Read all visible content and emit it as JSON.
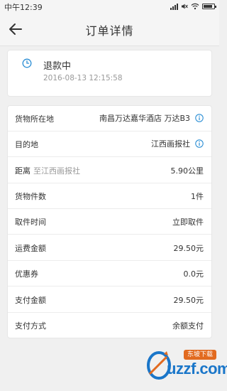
{
  "status_bar": {
    "time": "中午12:39",
    "battery_level": 0.85
  },
  "header": {
    "title": "订单详情",
    "back_icon": "arrow-left-icon"
  },
  "order_status": {
    "icon": "clock-icon",
    "label": "退款中",
    "timestamp": "2016-08-13 12:15:58"
  },
  "details": {
    "rows": [
      {
        "label": "货物所在地",
        "sub": "",
        "value": "南昌万达嘉华酒店 万达B3",
        "info_icon": true
      },
      {
        "label": "目的地",
        "sub": "",
        "value": "江西画报社",
        "info_icon": true
      },
      {
        "label": "距离",
        "sub": "至江西画报社",
        "value": "5.90公里",
        "info_icon": false
      },
      {
        "label": "货物件数",
        "sub": "",
        "value": "1件",
        "info_icon": false
      },
      {
        "label": "取件时间",
        "sub": "",
        "value": "立即取件",
        "info_icon": false
      },
      {
        "label": "运费金额",
        "sub": "",
        "value": "29.50元",
        "info_icon": false
      },
      {
        "label": "优惠券",
        "sub": "",
        "value": "0.0元",
        "info_icon": false
      },
      {
        "label": "支付金额",
        "sub": "",
        "value": "29.50元",
        "info_icon": false
      },
      {
        "label": "支付方式",
        "sub": "",
        "value": "余额支付",
        "info_icon": false
      }
    ]
  },
  "watermark": {
    "badge": "东坡下载",
    "text": "uzzf.com"
  },
  "colors": {
    "accent": "#2d8fd5",
    "background": "#f0f0f0",
    "card": "#ffffff",
    "muted_text": "#999999"
  }
}
